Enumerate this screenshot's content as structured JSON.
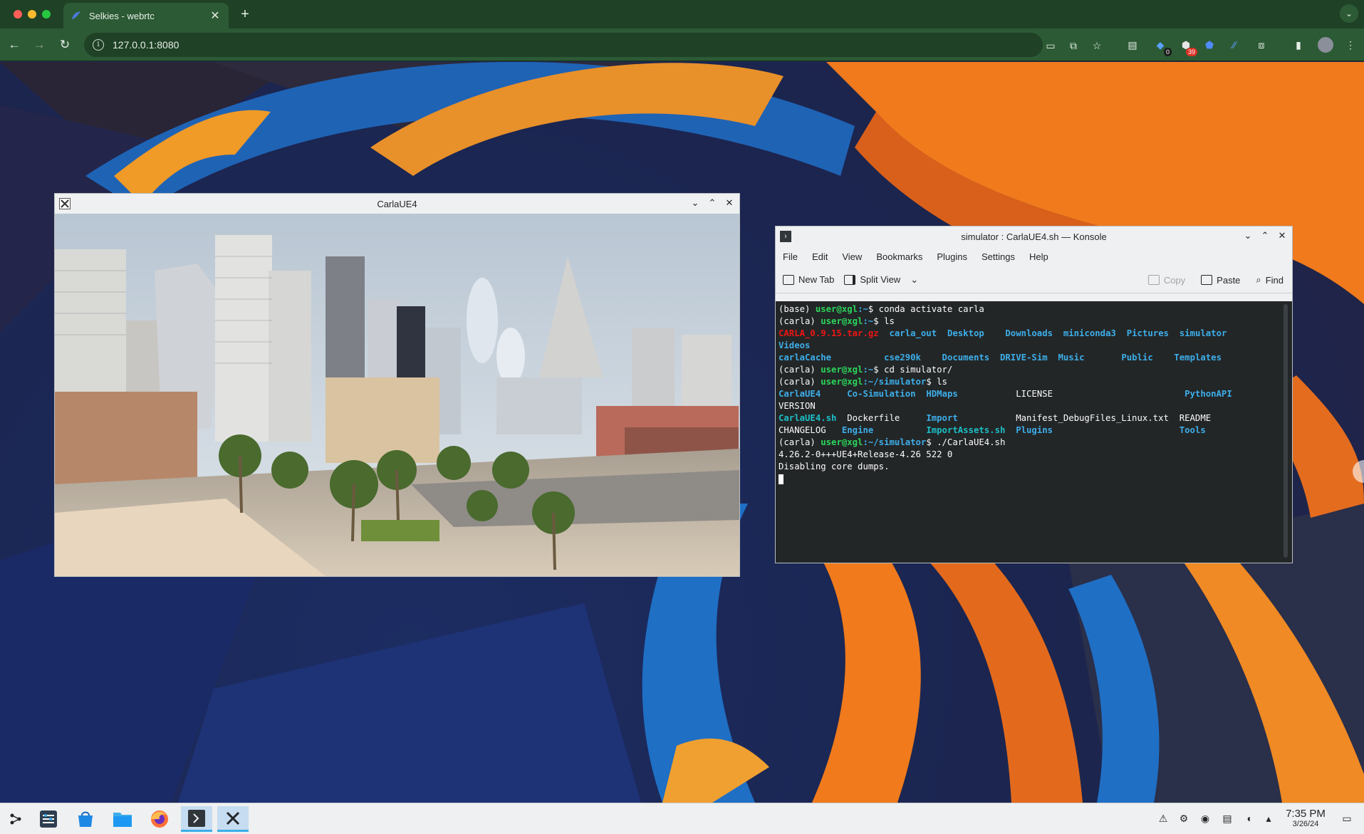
{
  "browser": {
    "tab_title": "Selkies - webrtc",
    "new_tab_label": "+",
    "url": "127.0.0.1:8080",
    "extensions": [
      {
        "icon": "notes-icon"
      },
      {
        "icon": "extension-badge-icon",
        "badge": "0"
      },
      {
        "icon": "ublock-icon",
        "badge": "39"
      },
      {
        "icon": "shield-icon"
      },
      {
        "icon": "ai-icon"
      },
      {
        "icon": "puzzle-icon"
      }
    ],
    "colors": {
      "frame": "#1f4126",
      "toolbar": "#2c5a35"
    }
  },
  "carla_window": {
    "title": "CarlaUE4"
  },
  "konsole": {
    "title": "simulator : CarlaUE4.sh — Konsole",
    "menu": [
      "File",
      "Edit",
      "View",
      "Bookmarks",
      "Plugins",
      "Settings",
      "Help"
    ],
    "toolbar": {
      "new_tab": "New Tab",
      "split_view": "Split View",
      "copy": "Copy",
      "paste": "Paste",
      "find": "Find"
    },
    "terminal": {
      "prompt_user": "user@xgl",
      "l1_env": "(base) ",
      "l1_path": ":~",
      "l1_cmd": "$ conda activate carla",
      "l2_env": "(carla) ",
      "l2_path": ":~",
      "l2_cmd": "$ ls",
      "ls1_row1": [
        "CARLA_0.9.15.tar.gz",
        "carla_out",
        "Desktop",
        "Downloads",
        "miniconda3",
        "Pictures",
        "simulator"
      ],
      "ls1_row2": [
        "Videos"
      ],
      "ls1_row3": [
        "carlaCache",
        "cse290k",
        "Documents",
        "DRIVE-Sim",
        "Music",
        "Public",
        "Templates"
      ],
      "l3_env": "(carla) ",
      "l3_path": ":~",
      "l3_cmd": "$ cd simulator/",
      "l4_env": "(carla) ",
      "l4_path": ":~/simulator",
      "l4_cmd": "$ ls",
      "ls2_row1": [
        "CarlaUE4",
        "Co-Simulation",
        "HDMaps",
        "LICENSE",
        "PythonAPI"
      ],
      "ls2_row2": [
        "VERSION"
      ],
      "ls2_row3": [
        "CarlaUE4.sh",
        "Dockerfile",
        "Import",
        "Manifest_DebugFiles_Linux.txt",
        "README"
      ],
      "ls2_row4": [
        "CHANGELOG",
        "Engine",
        "ImportAssets.sh",
        "Plugins",
        "Tools"
      ],
      "l5_env": "(carla) ",
      "l5_path": ":~/simulator",
      "l5_cmd": "$ ./CarlaUE4.sh",
      "out1": "4.26.2-0+++UE4+Release-4.26 522 0",
      "out2": "Disabling core dumps."
    }
  },
  "taskbar": {
    "apps": [
      {
        "icon": "app-launcher-icon"
      },
      {
        "icon": "system-settings-icon"
      },
      {
        "icon": "discover-icon"
      },
      {
        "icon": "file-manager-icon"
      },
      {
        "icon": "firefox-icon"
      },
      {
        "icon": "konsole-icon"
      },
      {
        "icon": "x-window-icon"
      }
    ],
    "time": "7:35 PM",
    "date": "3/26/24"
  }
}
